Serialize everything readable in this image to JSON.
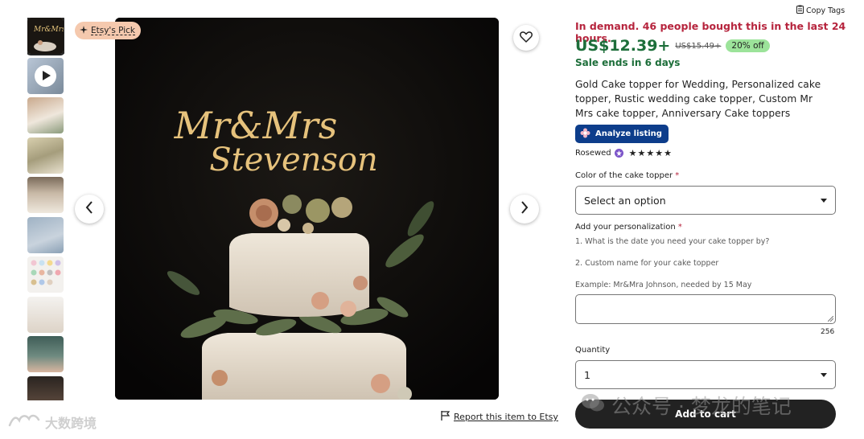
{
  "badge": {
    "label": "Etsy's Pick"
  },
  "copy_tags": {
    "label": "Copy Tags"
  },
  "listing": {
    "demand": "In demand. 46 people bought this in the last 24 hours.",
    "price": "US$12.39+",
    "original_price": "US$15.49+",
    "discount": "20% off",
    "sale_ends": "Sale ends in 6 days",
    "title": "Gold Cake topper for Wedding, Personalized cake topper, Rustic wedding cake topper, Custom Mr Mrs cake topper, Anniversary Cake toppers",
    "analyze_label": "Analyze listing",
    "shop_name": "Rosewed",
    "rating_stars": 5
  },
  "image": {
    "topper_line1": "Mr&Mrs",
    "topper_line2": "Stevenson"
  },
  "form": {
    "color_label": "Color of the cake topper",
    "color_value": "Select an option",
    "personalization_label": "Add your personalization",
    "instruction_1": "1. What is the date you need your cake topper by?",
    "instruction_2": "2. Custom name for your cake topper",
    "example": "Example: Mr&Mra Johnson, needed by 15 May",
    "char_count": "256",
    "quantity_label": "Quantity",
    "quantity_value": "1",
    "required_mark": "*"
  },
  "actions": {
    "add_to_cart": "Add to cart",
    "report": "Report this item to Etsy"
  },
  "watermarks": {
    "left": "大数跨境",
    "right": "公众号 · 梦龙的笔记"
  },
  "colors": {
    "demand_red": "#b6243d",
    "price_green": "#1d6e3a",
    "discount_badge": "#9ce39a",
    "etsy_pick_badge": "#f5c9ae",
    "analyze_blue": "#0d3d8b",
    "cart_button": "#222222"
  }
}
